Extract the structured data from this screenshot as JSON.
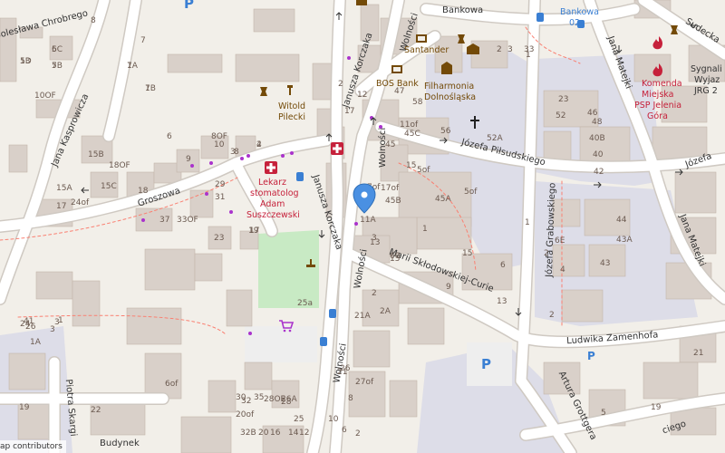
{
  "map": {
    "streets": {
      "boleslawa_chrobrego": "Bolesława Chrobrego",
      "jana_kasprowicza": "Jana Kasprowicza",
      "groszowa": "Groszowa",
      "janusza_korczaka_top": "Janusza Korczaka",
      "janusza_korczaka_mid": "Janusza Korczaka",
      "wolnosci_top": "Wolności",
      "wolnosci_mid": "Wolności",
      "wolnosci_low": "Wolności",
      "wolnosci_bottom": "Wolności",
      "bankowa": "Bankowa",
      "jana_matejki_top": "Jana Matejki",
      "jana_matejki_mid": "Jana Matejki",
      "sudecka": "Sudecka",
      "jozefa_pilsudskiego": "Józefa Piłsudskiego",
      "jozefa_right": "Józefa",
      "jozefa_grabowskiego": "Józefa Grabowskiego",
      "marii_sklodowskiej_curie": "Marii Skłodowskiej-Curie",
      "ludwika_zamenhofa": "Ludwika Zamenhofa",
      "piotra_skargi": "Piotra Skargi",
      "artura_grottgera": "Artura Grottgera",
      "budynek": "Budynek",
      "ciego": "ciego"
    },
    "pois": {
      "santander": "Santander",
      "bos_bank": "BOS Bank",
      "filharmonia": [
        "Filharmonia",
        "Dolnośląska"
      ],
      "witold": [
        "Witold",
        "Pilecki"
      ],
      "lekarz": [
        "Lekarz",
        "stomatolog",
        "Adam",
        "Suszczewski"
      ],
      "komenda": [
        "Komenda",
        "Miejska",
        "PSP Jelenia",
        "Góra"
      ],
      "sygnali": [
        "Sygnali",
        "Wyjaz",
        "JRG 2"
      ],
      "bankowa_02": [
        "Bankowa",
        "02"
      ]
    },
    "house_numbers": [
      "5D",
      "5C",
      "5B",
      "7A",
      "7B",
      "7",
      "10OF",
      "15B",
      "18OF",
      "15C",
      "15A",
      "17",
      "24of",
      "8",
      "9",
      "18",
      "10",
      "3",
      "2",
      "8OF",
      "6",
      "8",
      "4",
      "29",
      "31",
      "37",
      "33OF",
      "23",
      "19",
      "17",
      "25a",
      "24",
      "26",
      "22",
      "19",
      "1A",
      "41",
      "1",
      "3",
      "3",
      "35",
      "30",
      "32",
      "28OF",
      "26A",
      "27of",
      "26",
      "28",
      "25",
      "21",
      "21A",
      "2A",
      "2",
      "15",
      "13",
      "12",
      "2",
      "17",
      "47",
      "11of",
      "45C",
      "45",
      "15",
      "5of",
      "7of",
      "17of",
      "45B",
      "45A",
      "5of",
      "1",
      "3",
      "60",
      "58",
      "56",
      "52A",
      "52",
      "46",
      "48",
      "40B",
      "40",
      "42",
      "44",
      "43A",
      "43",
      "6E",
      "4",
      "2",
      "6",
      "3",
      "1",
      "2",
      "33",
      "23",
      "21",
      "19",
      "6of",
      "20of",
      "32B",
      "20",
      "16",
      "14",
      "12",
      "10",
      "8",
      "6",
      "2",
      "15",
      "9",
      "13",
      "2",
      "1",
      "5",
      "13",
      "6",
      "7",
      "1",
      "1"
    ],
    "marker_label": "11A",
    "colors": {
      "background": "#f2efe9",
      "building": "#d9d0c9",
      "road": "#ffffff",
      "road_casing": "#cfc9c2",
      "park": "#c8eac4",
      "pedestrian": "#dddde8",
      "parking": "#eeeeee",
      "poi_brown": "#734a08",
      "poi_red": "#c6213b",
      "poi_blue": "#3a7fd3",
      "marker": "#4a90e2",
      "purple_dot": "#aa33cc"
    },
    "icons": [
      "parking-icon",
      "bank-icon",
      "museum-icon",
      "christian-icon",
      "fire-station-icon",
      "doctor-icon",
      "shop-icon",
      "bus-stop-icon",
      "memorial-icon",
      "location-marker-icon"
    ]
  },
  "attribution": "ap contributors"
}
